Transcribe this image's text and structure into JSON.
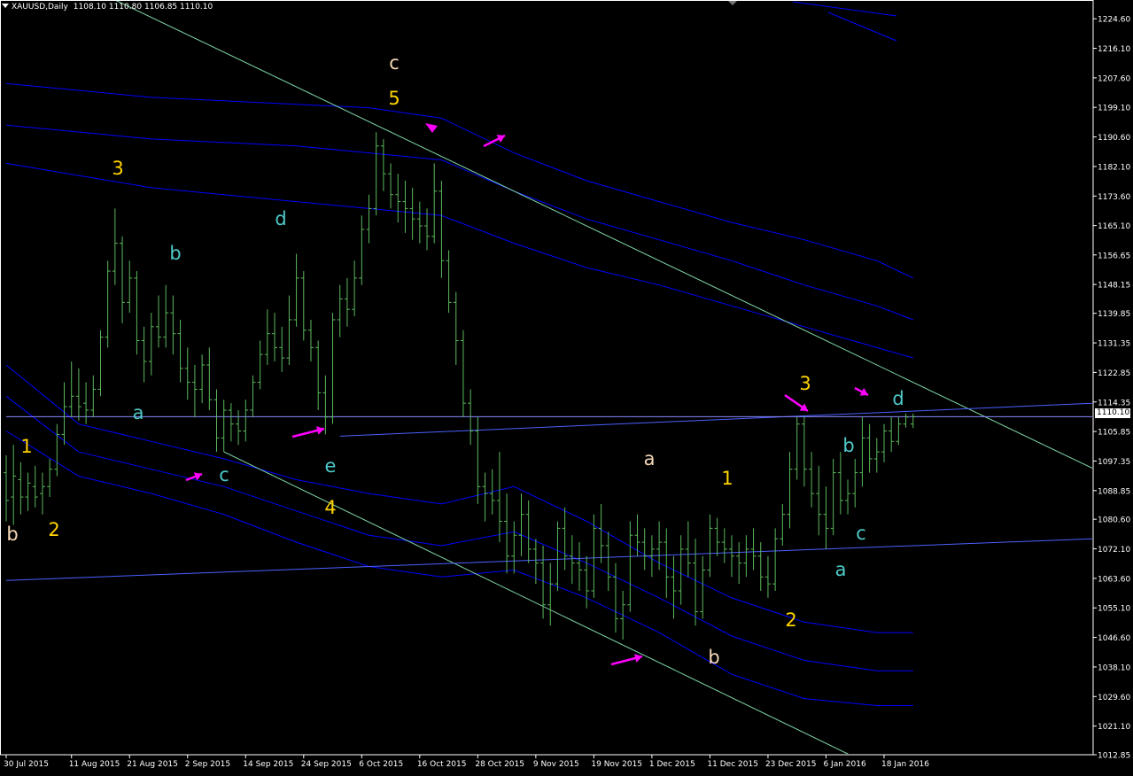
{
  "header": {
    "symbol": "XAUUSD,Daily",
    "ohlc": "1108.10 1110.80 1106.85 1110.10"
  },
  "current_price": "1110.10",
  "chart_data": {
    "type": "bar",
    "title": "XAUUSD,Daily",
    "xlabel": "",
    "ylabel": "",
    "ylim": [
      1012.85,
      1230
    ],
    "grid": false,
    "y_ticks": [
      "1224.60",
      "1216.10",
      "1207.60",
      "1199.10",
      "1190.60",
      "1182.10",
      "1173.60",
      "1165.10",
      "1156.65",
      "1148.15",
      "1139.85",
      "1131.35",
      "1122.85",
      "1114.35",
      "1105.85",
      "1097.35",
      "1088.85",
      "1080.60",
      "1072.10",
      "1063.60",
      "1055.10",
      "1046.60",
      "1038.10",
      "1029.60",
      "1021.10",
      "1012.85"
    ],
    "x_ticks": [
      "30 Jul 2015",
      "11 Aug 2015",
      "21 Aug 2015",
      "2 Sep 2015",
      "14 Sep 2015",
      "24 Sep 2015",
      "6 Oct 2015",
      "16 Oct 2015",
      "28 Oct 2015",
      "9 Nov 2015",
      "19 Nov 2015",
      "1 Dec 2015",
      "11 Dec 2015",
      "23 Dec 2015",
      "6 Jan 2016",
      "18 Jan 2016"
    ],
    "x_tick_bar_index": [
      0,
      9,
      17,
      25,
      33,
      41,
      49,
      57,
      65,
      73,
      81,
      89,
      97,
      105,
      113,
      121
    ],
    "bars_count": 126,
    "ohlc_bars": [
      [
        1094,
        1099,
        1080,
        1086
      ],
      [
        1087,
        1102,
        1079,
        1093
      ],
      [
        1092,
        1097,
        1082,
        1087
      ],
      [
        1087,
        1094,
        1083,
        1091
      ],
      [
        1090,
        1096,
        1084,
        1087
      ],
      [
        1088,
        1094,
        1082,
        1090
      ],
      [
        1090,
        1098,
        1087,
        1095
      ],
      [
        1095,
        1108,
        1093,
        1105
      ],
      [
        1105,
        1120,
        1102,
        1113
      ],
      [
        1113,
        1126,
        1110,
        1116
      ],
      [
        1116,
        1124,
        1109,
        1113
      ],
      [
        1114,
        1120,
        1108,
        1112
      ],
      [
        1112,
        1122,
        1110,
        1118
      ],
      [
        1118,
        1135,
        1116,
        1133
      ],
      [
        1133,
        1155,
        1130,
        1152
      ],
      [
        1152,
        1170,
        1148,
        1160
      ],
      [
        1160,
        1162,
        1137,
        1143
      ],
      [
        1143,
        1155,
        1140,
        1150
      ],
      [
        1150,
        1152,
        1128,
        1132
      ],
      [
        1132,
        1136,
        1120,
        1126
      ],
      [
        1126,
        1140,
        1122,
        1136
      ],
      [
        1136,
        1145,
        1130,
        1133
      ],
      [
        1133,
        1148,
        1130,
        1140
      ],
      [
        1140,
        1145,
        1128,
        1134
      ],
      [
        1134,
        1138,
        1120,
        1124
      ],
      [
        1124,
        1130,
        1115,
        1120
      ],
      [
        1120,
        1125,
        1110,
        1118
      ],
      [
        1118,
        1128,
        1114,
        1125
      ],
      [
        1125,
        1130,
        1112,
        1115
      ],
      [
        1115,
        1118,
        1100,
        1104
      ],
      [
        1104,
        1115,
        1100,
        1112
      ],
      [
        1112,
        1114,
        1103,
        1108
      ],
      [
        1108,
        1112,
        1102,
        1106
      ],
      [
        1106,
        1115,
        1103,
        1112
      ],
      [
        1112,
        1122,
        1110,
        1120
      ],
      [
        1120,
        1132,
        1118,
        1128
      ],
      [
        1128,
        1141,
        1125,
        1134
      ],
      [
        1134,
        1140,
        1126,
        1130
      ],
      [
        1130,
        1136,
        1123,
        1127
      ],
      [
        1127,
        1145,
        1125,
        1138
      ],
      [
        1138,
        1157,
        1136,
        1150
      ],
      [
        1150,
        1152,
        1132,
        1135
      ],
      [
        1135,
        1138,
        1126,
        1130
      ],
      [
        1130,
        1132,
        1112,
        1117
      ],
      [
        1117,
        1122,
        1105,
        1110
      ],
      [
        1110,
        1140,
        1108,
        1138
      ],
      [
        1138,
        1148,
        1133,
        1144
      ],
      [
        1144,
        1150,
        1136,
        1141
      ],
      [
        1141,
        1155,
        1139,
        1150
      ],
      [
        1150,
        1168,
        1148,
        1164
      ],
      [
        1164,
        1174,
        1160,
        1170
      ],
      [
        1170,
        1192,
        1168,
        1188
      ],
      [
        1188,
        1190,
        1175,
        1180
      ],
      [
        1180,
        1183,
        1170,
        1174
      ],
      [
        1174,
        1180,
        1166,
        1172
      ],
      [
        1172,
        1178,
        1163,
        1170
      ],
      [
        1170,
        1176,
        1161,
        1167
      ],
      [
        1167,
        1172,
        1160,
        1165
      ],
      [
        1165,
        1170,
        1158,
        1162
      ],
      [
        1162,
        1183,
        1160,
        1175
      ],
      [
        1175,
        1178,
        1150,
        1155
      ],
      [
        1155,
        1158,
        1140,
        1143
      ],
      [
        1143,
        1146,
        1125,
        1132
      ],
      [
        1132,
        1135,
        1110,
        1114
      ],
      [
        1114,
        1118,
        1102,
        1106
      ],
      [
        1106,
        1110,
        1085,
        1090
      ],
      [
        1090,
        1094,
        1080,
        1088
      ],
      [
        1088,
        1095,
        1082,
        1086
      ],
      [
        1086,
        1100,
        1074,
        1080
      ],
      [
        1080,
        1088,
        1065,
        1070
      ],
      [
        1070,
        1080,
        1065,
        1076
      ],
      [
        1076,
        1088,
        1070,
        1082
      ],
      [
        1082,
        1086,
        1068,
        1072
      ],
      [
        1072,
        1075,
        1062,
        1068
      ],
      [
        1068,
        1073,
        1052,
        1056
      ],
      [
        1056,
        1068,
        1050,
        1062
      ],
      [
        1062,
        1080,
        1060,
        1078
      ],
      [
        1078,
        1084,
        1066,
        1070
      ],
      [
        1070,
        1076,
        1062,
        1068
      ],
      [
        1068,
        1074,
        1060,
        1066
      ],
      [
        1066,
        1070,
        1055,
        1060
      ],
      [
        1060,
        1082,
        1058,
        1078
      ],
      [
        1078,
        1085,
        1068,
        1073
      ],
      [
        1073,
        1077,
        1060,
        1064
      ],
      [
        1064,
        1068,
        1048,
        1052
      ],
      [
        1052,
        1060,
        1046,
        1056
      ],
      [
        1056,
        1080,
        1054,
        1076
      ],
      [
        1076,
        1082,
        1070,
        1074
      ],
      [
        1074,
        1078,
        1066,
        1070
      ],
      [
        1070,
        1076,
        1064,
        1072
      ],
      [
        1072,
        1080,
        1066,
        1074
      ],
      [
        1074,
        1078,
        1058,
        1064
      ],
      [
        1064,
        1070,
        1052,
        1060
      ],
      [
        1060,
        1076,
        1056,
        1072
      ],
      [
        1072,
        1080,
        1064,
        1068
      ],
      [
        1068,
        1075,
        1050,
        1054
      ],
      [
        1054,
        1070,
        1052,
        1066
      ],
      [
        1066,
        1082,
        1064,
        1078
      ],
      [
        1078,
        1081,
        1070,
        1074
      ],
      [
        1074,
        1078,
        1068,
        1072
      ],
      [
        1072,
        1076,
        1064,
        1070
      ],
      [
        1070,
        1074,
        1062,
        1068
      ],
      [
        1068,
        1076,
        1064,
        1072
      ],
      [
        1072,
        1078,
        1066,
        1070
      ],
      [
        1070,
        1074,
        1060,
        1064
      ],
      [
        1064,
        1070,
        1058,
        1062
      ],
      [
        1062,
        1078,
        1060,
        1075
      ],
      [
        1075,
        1085,
        1073,
        1082
      ],
      [
        1082,
        1100,
        1078,
        1095
      ],
      [
        1095,
        1110,
        1092,
        1108
      ],
      [
        1108,
        1110,
        1090,
        1095
      ],
      [
        1095,
        1100,
        1084,
        1088
      ],
      [
        1088,
        1096,
        1076,
        1082
      ],
      [
        1082,
        1090,
        1072,
        1078
      ],
      [
        1078,
        1098,
        1076,
        1094
      ],
      [
        1094,
        1100,
        1082,
        1086
      ],
      [
        1086,
        1092,
        1082,
        1088
      ],
      [
        1088,
        1098,
        1084,
        1094
      ],
      [
        1094,
        1110,
        1090,
        1104
      ],
      [
        1104,
        1108,
        1094,
        1098
      ],
      [
        1098,
        1104,
        1094,
        1100
      ],
      [
        1100,
        1108,
        1097,
        1106
      ],
      [
        1106,
        1110,
        1100,
        1103
      ],
      [
        1103,
        1110,
        1102,
        1108
      ],
      [
        1108,
        1111,
        1107,
        1110
      ],
      [
        1108,
        1111,
        1106.85,
        1110.1
      ]
    ],
    "series": [
      {
        "color": "#0000ff",
        "points": [
          [
            0,
            1206
          ],
          [
            20,
            1202
          ],
          [
            40,
            1200
          ],
          [
            50,
            1199
          ],
          [
            60,
            1196
          ],
          [
            70,
            1186
          ],
          [
            80,
            1178
          ],
          [
            90,
            1172
          ],
          [
            100,
            1166
          ],
          [
            110,
            1161
          ],
          [
            120,
            1155
          ],
          [
            125,
            1150
          ]
        ]
      },
      {
        "color": "#0000ff",
        "points": [
          [
            0,
            1194
          ],
          [
            20,
            1190
          ],
          [
            40,
            1188
          ],
          [
            50,
            1186
          ],
          [
            60,
            1184
          ],
          [
            70,
            1175
          ],
          [
            80,
            1167
          ],
          [
            90,
            1161
          ],
          [
            100,
            1155
          ],
          [
            110,
            1148
          ],
          [
            120,
            1142
          ],
          [
            125,
            1138
          ]
        ]
      },
      {
        "color": "#0000ff",
        "points": [
          [
            0,
            1183
          ],
          [
            20,
            1176
          ],
          [
            40,
            1172
          ],
          [
            50,
            1170
          ],
          [
            60,
            1168
          ],
          [
            70,
            1160
          ],
          [
            80,
            1153
          ],
          [
            90,
            1148
          ],
          [
            100,
            1142
          ],
          [
            110,
            1136
          ],
          [
            120,
            1130
          ],
          [
            125,
            1127
          ]
        ]
      },
      {
        "color": "#0000ff",
        "points": [
          [
            0,
            1125
          ],
          [
            10,
            1108
          ],
          [
            20,
            1103
          ],
          [
            30,
            1098
          ],
          [
            40,
            1092
          ],
          [
            50,
            1088
          ],
          [
            60,
            1085
          ],
          [
            70,
            1090
          ],
          [
            80,
            1080
          ],
          [
            90,
            1068
          ],
          [
            100,
            1058
          ],
          [
            110,
            1051
          ],
          [
            120,
            1048
          ],
          [
            125,
            1048
          ]
        ]
      },
      {
        "color": "#0000ff",
        "points": [
          [
            0,
            1116
          ],
          [
            10,
            1100
          ],
          [
            20,
            1095
          ],
          [
            30,
            1090
          ],
          [
            40,
            1083
          ],
          [
            50,
            1076
          ],
          [
            60,
            1073
          ],
          [
            70,
            1077
          ],
          [
            80,
            1068
          ],
          [
            90,
            1058
          ],
          [
            100,
            1047
          ],
          [
            110,
            1040
          ],
          [
            120,
            1037
          ],
          [
            125,
            1037
          ]
        ]
      },
      {
        "color": "#0000ff",
        "points": [
          [
            0,
            1106
          ],
          [
            10,
            1093
          ],
          [
            20,
            1088
          ],
          [
            30,
            1082
          ],
          [
            40,
            1074
          ],
          [
            50,
            1067
          ],
          [
            60,
            1064
          ],
          [
            70,
            1066
          ],
          [
            80,
            1058
          ],
          [
            90,
            1048
          ],
          [
            100,
            1036
          ],
          [
            110,
            1029
          ],
          [
            120,
            1027
          ],
          [
            125,
            1027
          ]
        ]
      }
    ],
    "trendlines": [
      {
        "color": "#7fd8a8",
        "from": [
          0,
          1245
        ],
        "to": [
          150,
          1095
        ]
      },
      {
        "color": "#7fd8a8",
        "from": [
          30,
          1100
        ],
        "to": [
          125,
          1004
        ]
      },
      {
        "color": "#4a60ff",
        "from": [
          0,
          1063
        ],
        "to": [
          150,
          1075
        ]
      },
      {
        "color": "#4a60ff",
        "from": [
          46,
          1104.5
        ],
        "to": [
          150,
          1114
        ]
      },
      {
        "color": "#8888ff",
        "from": [
          0,
          1110.1
        ],
        "to": [
          150,
          1110.1
        ]
      }
    ],
    "annotations": [
      {
        "text": "c",
        "color": "#f5d8b8"
      },
      {
        "text": "5",
        "color": "#ffd400"
      },
      {
        "text": "3",
        "color": "#ffd400"
      },
      {
        "text": "d",
        "color": "#4ec9c9"
      },
      {
        "text": "b",
        "color": "#4ec9c9"
      },
      {
        "text": "a",
        "color": "#4ec9c9"
      },
      {
        "text": "c",
        "color": "#4ec9c9"
      },
      {
        "text": "e",
        "color": "#4ec9c9"
      },
      {
        "text": "4",
        "color": "#ffd400"
      },
      {
        "text": "1",
        "color": "#ffd400"
      },
      {
        "text": "2",
        "color": "#ffd400"
      },
      {
        "text": "b",
        "color": "#f5d8b8"
      },
      {
        "text": "a",
        "color": "#f5d8b8"
      },
      {
        "text": "1",
        "color": "#ffd400"
      },
      {
        "text": "2",
        "color": "#ffd400"
      },
      {
        "text": "b",
        "color": "#f5d8b8"
      },
      {
        "text": "3",
        "color": "#ffd400"
      },
      {
        "text": "d",
        "color": "#4ec9c9"
      },
      {
        "text": "b",
        "color": "#4ec9c9"
      },
      {
        "text": "c",
        "color": "#4ec9c9"
      },
      {
        "text": "a",
        "color": "#4ec9c9"
      }
    ],
    "colors": {
      "background": "#000000",
      "bars": "#5cb85c",
      "axis": "#ffffff",
      "arrows": "#ff00ff"
    }
  }
}
